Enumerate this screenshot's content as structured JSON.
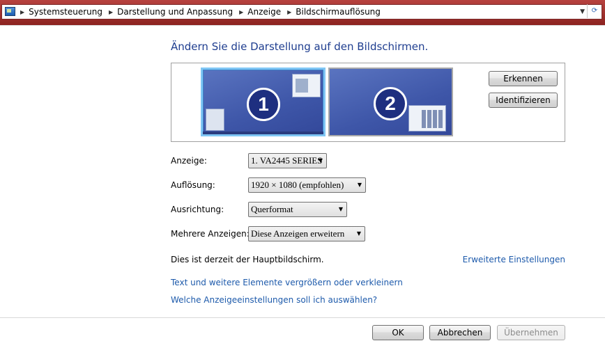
{
  "address_bar": {
    "breadcrumbs": [
      "Systemsteuerung",
      "Darstellung und Anpassung",
      "Anzeige",
      "Bildschirmauflösung"
    ]
  },
  "page_title": "Ändern Sie die Darstellung auf den Bildschirmen.",
  "preview": {
    "monitors": [
      {
        "number": "1",
        "selected": true
      },
      {
        "number": "2",
        "selected": false
      }
    ],
    "detect_button": "Erkennen",
    "identify_button": "Identifizieren"
  },
  "settings": {
    "display_label": "Anzeige:",
    "display_value": "1. VA2445 SERIES",
    "resolution_label": "Auflösung:",
    "resolution_value": "1920 × 1080 (empfohlen)",
    "orientation_label": "Ausrichtung:",
    "orientation_value": "Querformat",
    "multiple_label": "Mehrere Anzeigen:",
    "multiple_value": "Diese Anzeigen erweitern"
  },
  "status_text": "Dies ist derzeit der Hauptbildschirm.",
  "links": {
    "advanced": "Erweiterte Einstellungen",
    "text_size": "Text und weitere Elemente vergrößern oder verkleinern",
    "which_settings": "Welche Anzeigeeinstellungen soll ich auswählen?"
  },
  "footer": {
    "ok": "OK",
    "cancel": "Abbrechen",
    "apply": "Übernehmen",
    "apply_enabled": false
  },
  "colors": {
    "title": "#1e3d8f",
    "link": "#1d5aab",
    "address_frame": "#8c2320",
    "monitor_fill": "#3e56a8"
  }
}
